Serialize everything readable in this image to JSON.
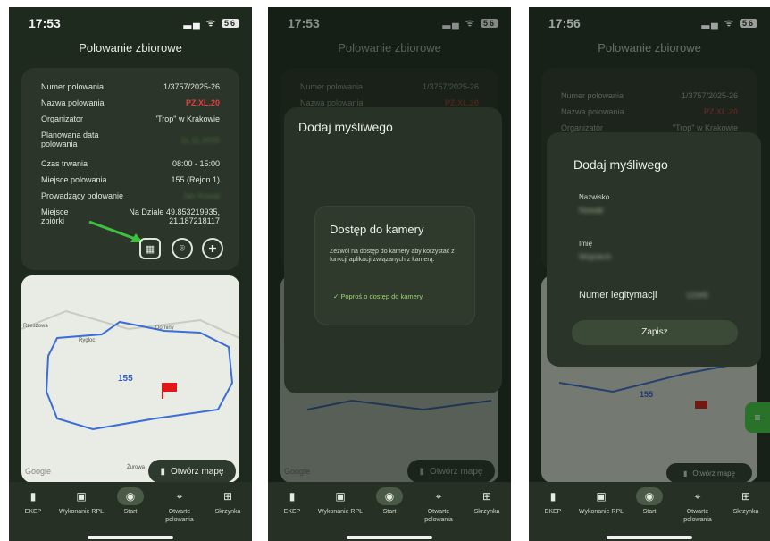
{
  "status": {
    "time1": "17:53",
    "time2": "17:53",
    "time3": "17:56",
    "battery": "56"
  },
  "header": {
    "title": "Polowanie zbiorowe"
  },
  "details": {
    "hunt_number_label": "Numer polowania",
    "hunt_number": "1/3757/2025-26",
    "hunt_name_label": "Nazwa polowania",
    "hunt_name": "PZ.XL.20",
    "organizer_label": "Organizator",
    "organizer": "\"Trop\" w Krakowie",
    "planned_date_label": "Planowana data polowania",
    "planned_date": "11.11.2025",
    "duration_label": "Czas trwania",
    "duration": "08:00 - 15:00",
    "place_label": "Miejsce polowania",
    "place": "155 (Rejon 1)",
    "leader_label": "Prowadzący polowanie",
    "leader": "Jan Kowal",
    "meeting_label": "Miejsce zbiórki",
    "meeting": "Na Dziale 49.853219935, 21.187218117"
  },
  "icons": {
    "qr": "qr-scan-icon",
    "location": "location-pin-icon",
    "add_person": "add-person-icon"
  },
  "map": {
    "area_label": "155",
    "places": [
      "Rzeszowa",
      "Rygloc",
      "Dorniny",
      "Żurowa"
    ],
    "open_map": "Otwórz mapę",
    "google": "Google"
  },
  "nav": [
    {
      "icon": "▮",
      "label": "EKEP"
    },
    {
      "icon": "▣",
      "label": "Wykonanie RPŁ"
    },
    {
      "icon": "◉",
      "label": "Start"
    },
    {
      "icon": "⌖",
      "label": "Otwarte polowania"
    },
    {
      "icon": "⊞",
      "label": "Skrzynka"
    }
  ],
  "camera_dialog": {
    "sheet_title": "Dodaj myśliwego",
    "title": "Dostęp do kamery",
    "body": "Zezwól na dostęp do kamery aby korzystać z funkcji aplikacji związanych z kamerą.",
    "action": "✓  Poproś o dostęp do kamery"
  },
  "add_hunter": {
    "title": "Dodaj myśliwego",
    "surname_label": "Nazwisko",
    "surname_value": "Nowak",
    "name_label": "Imię",
    "name_value": "Wojciech",
    "license_label": "Numer legitymacji",
    "license_value": "12345",
    "save": "Zapisz"
  }
}
